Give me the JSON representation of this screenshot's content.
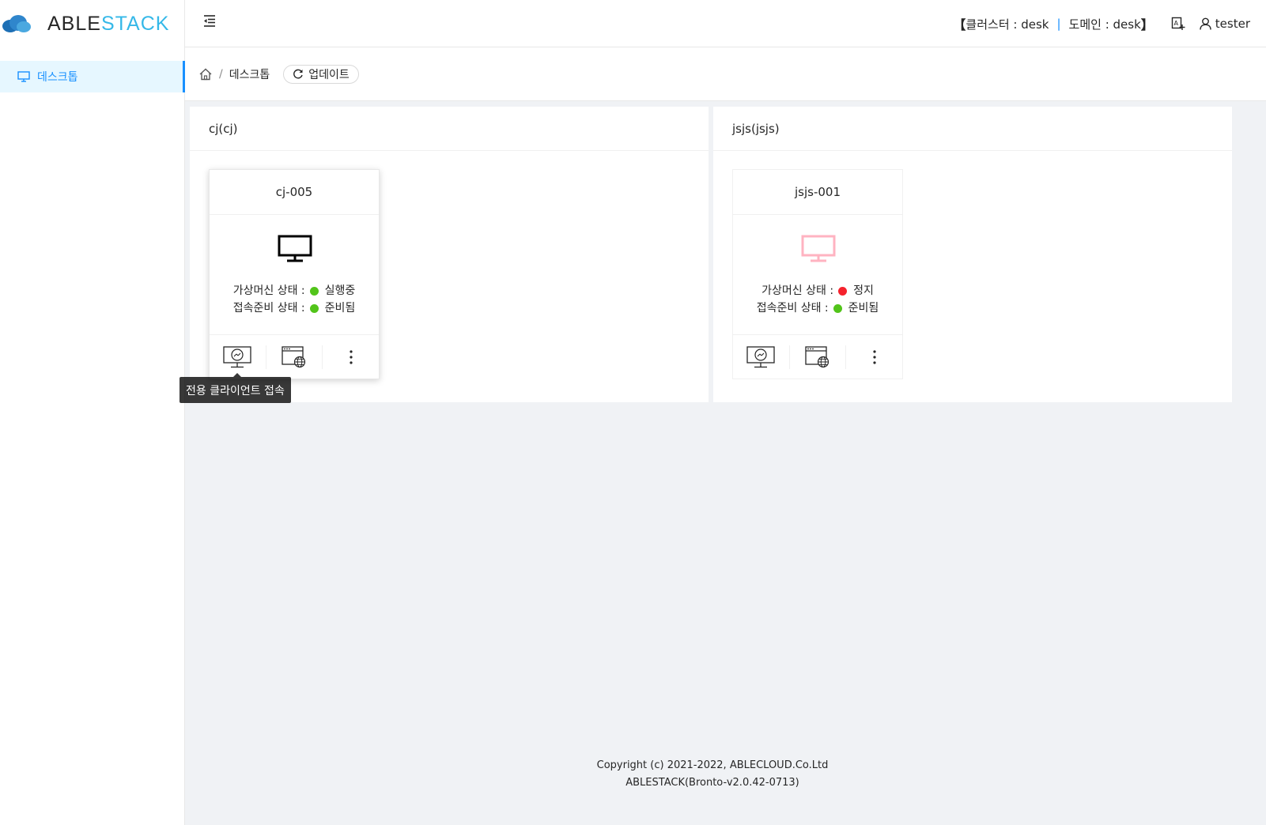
{
  "brand": {
    "part1": "ABLE",
    "part2": "STACK",
    "accent": "#35b8e8",
    "cloud_dark": "#1d6fb5",
    "cloud_light": "#4aa8e0"
  },
  "sidebar": {
    "items": [
      {
        "label": "데스크톱",
        "icon": "desktop-icon",
        "selected": true
      }
    ]
  },
  "header": {
    "bracket_open": "【",
    "cluster_label": "클러스터 : desk",
    "separator": "|",
    "domain_label": "도메인 : desk",
    "bracket_close": "】",
    "lang_icon": "translate-icon",
    "user_icon": "user-icon",
    "username": "tester"
  },
  "breadcrumb": {
    "home_icon": "home-icon",
    "separator": "/",
    "current": "데스크톱",
    "update_label": "업데이트"
  },
  "groups": [
    {
      "title": "cj(cj)",
      "vms": [
        {
          "name": "cj-005",
          "monitor_color": "#000000",
          "vm_state_label": "가상머신 상태 :",
          "vm_state_color": "#52c41a",
          "vm_state": "실행중",
          "conn_state_label": "접속준비 상태 :",
          "conn_state_color": "#52c41a",
          "conn_state": "준비됨"
        }
      ]
    },
    {
      "title": "jsjs(jsjs)",
      "vms": [
        {
          "name": "jsjs-001",
          "monitor_color": "#ffb3c1",
          "vm_state_label": "가상머신 상태 :",
          "vm_state_color": "#f5222d",
          "vm_state": "정지",
          "conn_state_label": "접속준비 상태 :",
          "conn_state_color": "#52c41a",
          "conn_state": "준비됨"
        }
      ]
    }
  ],
  "tooltip": "전용 클라이언트 접속",
  "footer": {
    "line1": "Copyright (c) 2021-2022, ABLECLOUD.Co.Ltd",
    "line2": "ABLESTACK(Bronto-v2.0.42-0713)"
  }
}
